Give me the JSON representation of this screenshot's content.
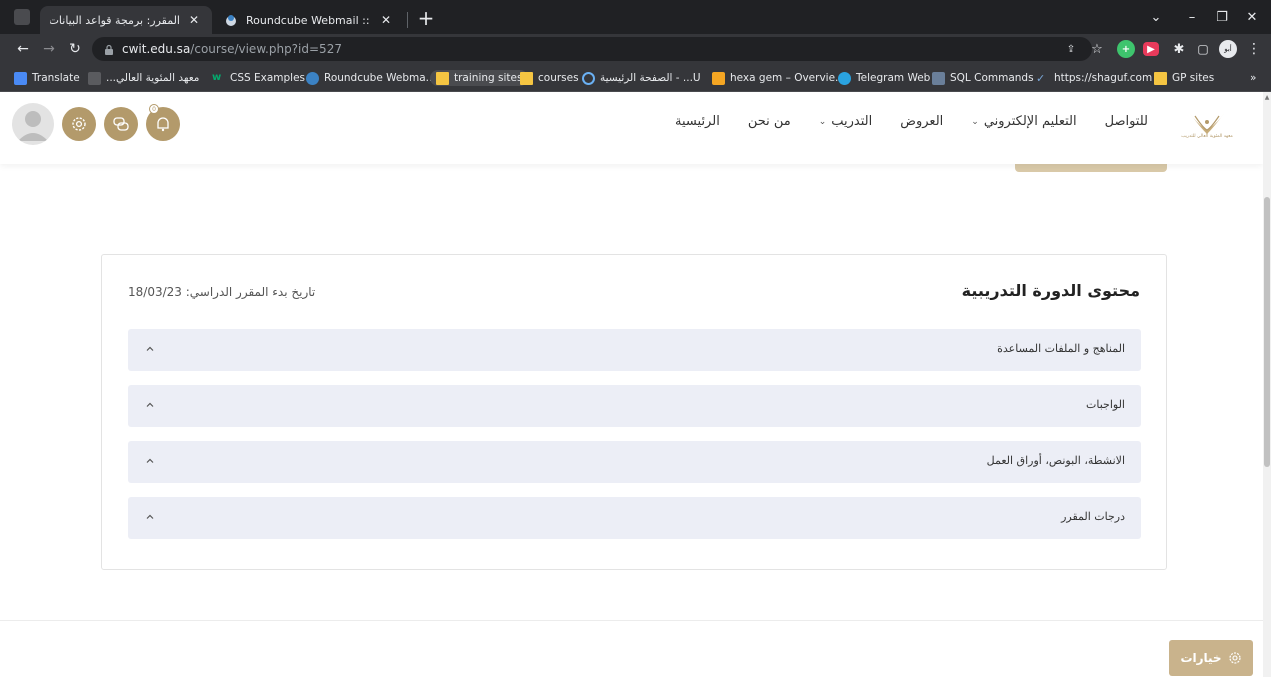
{
  "browser": {
    "tabs": [
      {
        "title": "المقرر: برمجة قواعد البيانات",
        "active": true
      },
      {
        "title": "Roundcube Webmail :: Inbox",
        "active": false
      }
    ],
    "new_tab_label": "+",
    "window_controls": {
      "minimize": "–",
      "maximize": "❐",
      "close": "✕",
      "dropdown": "⌄"
    },
    "address": {
      "host": "cwit.edu.sa",
      "path": "/course/view.php?id=527"
    },
    "toolbar_ext": {
      "profile": "أبو"
    },
    "bookmarks": [
      {
        "label": "Translate"
      },
      {
        "label": "معهد المئوية العالي..."
      },
      {
        "label": "CSS Examples"
      },
      {
        "label": "Roundcube Webma..."
      },
      {
        "label": "training sites"
      },
      {
        "label": "courses"
      },
      {
        "label": "الصفحة الرئيسية - ...U"
      },
      {
        "label": "hexa gem – Overvie..."
      },
      {
        "label": "Telegram Web"
      },
      {
        "label": "SQL Commands"
      },
      {
        "label": "https://shaguf.com"
      },
      {
        "label": "GP sites"
      }
    ],
    "bookmarks_overflow": "»"
  },
  "site": {
    "logo_text": "معهد المئوية العالي للتدريب",
    "nav": [
      {
        "label": "الرئيسية",
        "has_caret": false
      },
      {
        "label": "من نحن",
        "has_caret": false
      },
      {
        "label": "التدريب",
        "has_caret": true
      },
      {
        "label": "العروض",
        "has_caret": false
      },
      {
        "label": "التعليم الإلكتروني",
        "has_caret": true
      },
      {
        "label": "للتواصل",
        "has_caret": false
      }
    ],
    "notification_count": "0",
    "accent_color": "#b39a6b"
  },
  "course": {
    "title": "محتوى الدورة التدريبية",
    "start_date": "تاريخ بدء المقرر الدراسي: 18/03/23",
    "sections": [
      {
        "label": "المناهج و الملفات المساعدة"
      },
      {
        "label": "الواجبات"
      },
      {
        "label": "الانشطة، البونص، أوراق العمل"
      },
      {
        "label": "درجات المقرر"
      }
    ]
  },
  "options_button": {
    "label": "خيارات"
  }
}
